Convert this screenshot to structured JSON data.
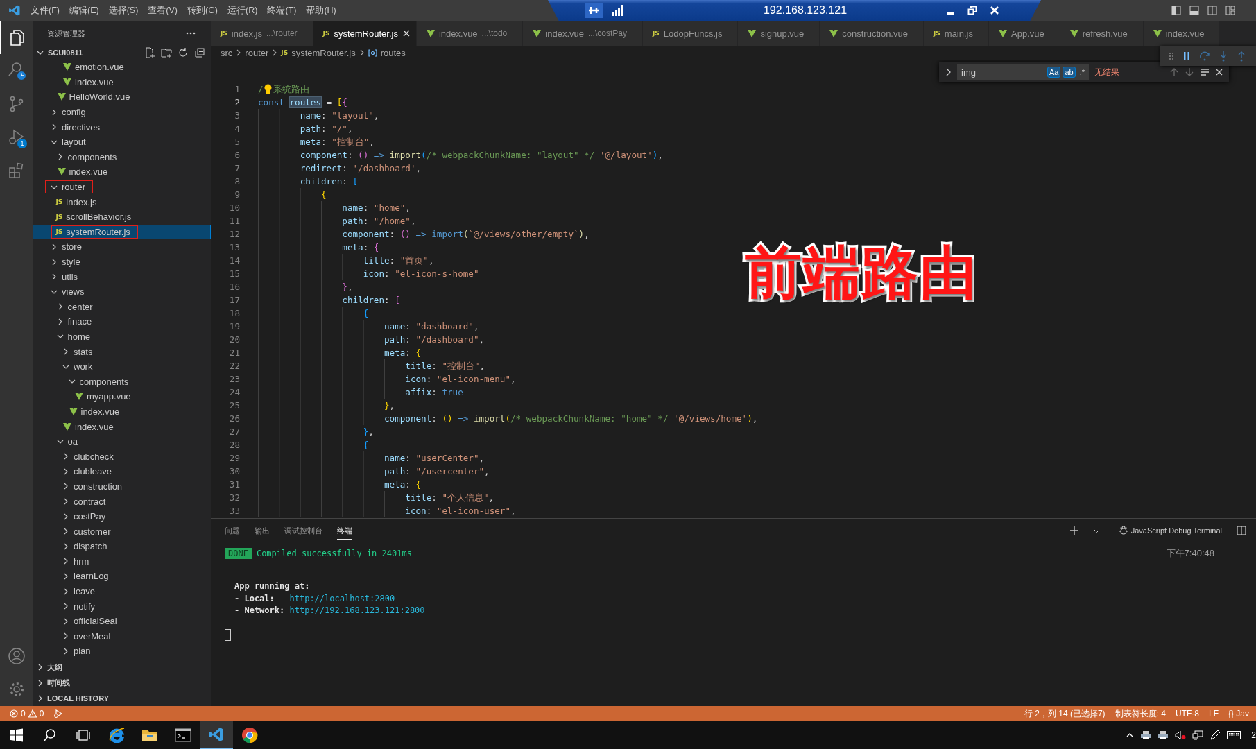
{
  "menu": [
    "文件(F)",
    "编辑(E)",
    "选择(S)",
    "查看(V)",
    "转到(G)",
    "运行(R)",
    "终端(T)",
    "帮助(H)"
  ],
  "remote_bar": {
    "title": "192.168.123.121"
  },
  "activity_bar": [
    {
      "kind": "files",
      "selected": true
    },
    {
      "kind": "search",
      "selected": false
    },
    {
      "kind": "source-control",
      "selected": false
    },
    {
      "kind": "run-debug",
      "selected": false,
      "badge": "1"
    },
    {
      "kind": "extensions",
      "selected": false
    }
  ],
  "activity_bottom": [
    {
      "kind": "account"
    },
    {
      "kind": "settings"
    }
  ],
  "sidebar": {
    "title": "资源管理器",
    "root": {
      "label": "SCUI0811",
      "expanded": true
    },
    "tree": [
      {
        "children": [
          {
            "children": [
              {
                "name": "emotion.vue",
                "kind": "vue",
                "selected": false,
                "marked": false
              },
              {
                "name": "index.vue",
                "kind": "vue",
                "selected": false,
                "marked": false
              }
            ]
          },
          {
            "name": "HelloWorld.vue",
            "kind": "vue",
            "selected": false,
            "marked": false
          }
        ]
      },
      {
        "name": "config",
        "kind": "folder",
        "expanded": false,
        "selected": false,
        "marked": false
      },
      {
        "name": "directives",
        "kind": "folder",
        "expanded": false,
        "selected": false,
        "marked": false
      },
      {
        "name": "layout",
        "kind": "folder",
        "expanded": true,
        "selected": false,
        "marked": false,
        "children": [
          {
            "name": "components",
            "kind": "folder",
            "expanded": false,
            "selected": false,
            "marked": false
          },
          {
            "name": "index.vue",
            "kind": "vue",
            "selected": false,
            "marked": false
          }
        ]
      },
      {
        "name": "router",
        "kind": "folder",
        "expanded": true,
        "selected": false,
        "marked": true,
        "children": [
          {
            "name": "index.js",
            "kind": "js",
            "badge": "JS",
            "selected": false,
            "marked": false
          },
          {
            "name": "scrollBehavior.js",
            "kind": "js",
            "badge": "JS",
            "selected": false,
            "marked": false
          },
          {
            "name": "systemRouter.js",
            "kind": "js",
            "badge": "JS",
            "selected": true,
            "marked": true
          }
        ]
      },
      {
        "name": "store",
        "kind": "folder",
        "expanded": false,
        "selected": false,
        "marked": false
      },
      {
        "name": "style",
        "kind": "folder",
        "expanded": false,
        "selected": false,
        "marked": false
      },
      {
        "name": "utils",
        "kind": "folder",
        "expanded": false,
        "selected": false,
        "marked": false
      },
      {
        "name": "views",
        "kind": "folder",
        "expanded": true,
        "selected": false,
        "marked": false,
        "children": [
          {
            "name": "center",
            "kind": "folder",
            "expanded": false,
            "selected": false,
            "marked": false
          },
          {
            "name": "finace",
            "kind": "folder",
            "expanded": false,
            "selected": false,
            "marked": false
          },
          {
            "name": "home",
            "kind": "folder",
            "expanded": true,
            "selected": false,
            "marked": false,
            "children": [
              {
                "name": "stats",
                "kind": "folder",
                "expanded": false,
                "selected": false,
                "marked": false
              },
              {
                "name": "work",
                "kind": "folder",
                "expanded": true,
                "selected": false,
                "marked": false,
                "children": [
                  {
                    "name": "components",
                    "kind": "folder",
                    "expanded": true,
                    "selected": false,
                    "marked": false,
                    "children": [
                      {
                        "name": "myapp.vue",
                        "kind": "vue",
                        "selected": false,
                        "marked": false
                      }
                    ]
                  },
                  {
                    "name": "index.vue",
                    "kind": "vue",
                    "selected": false,
                    "marked": false
                  }
                ]
              },
              {
                "name": "index.vue",
                "kind": "vue",
                "selected": false,
                "marked": false
              }
            ]
          },
          {
            "name": "oa",
            "kind": "folder",
            "expanded": true,
            "selected": false,
            "marked": false,
            "children": [
              {
                "name": "clubcheck",
                "kind": "folder",
                "expanded": false,
                "selected": false,
                "marked": false
              },
              {
                "name": "clubleave",
                "kind": "folder",
                "expanded": false,
                "selected": false,
                "marked": false
              },
              {
                "name": "construction",
                "kind": "folder",
                "expanded": false,
                "selected": false,
                "marked": false
              },
              {
                "name": "contract",
                "kind": "folder",
                "expanded": false,
                "selected": false,
                "marked": false
              },
              {
                "name": "costPay",
                "kind": "folder",
                "expanded": false,
                "selected": false,
                "marked": false
              },
              {
                "name": "customer",
                "kind": "folder",
                "expanded": false,
                "selected": false,
                "marked": false
              },
              {
                "name": "dispatch",
                "kind": "folder",
                "expanded": false,
                "selected": false,
                "marked": false
              },
              {
                "name": "hrm",
                "kind": "folder",
                "expanded": false,
                "selected": false,
                "marked": false
              },
              {
                "name": "learnLog",
                "kind": "folder",
                "expanded": false,
                "selected": false,
                "marked": false
              },
              {
                "name": "leave",
                "kind": "folder",
                "expanded": false,
                "selected": false,
                "marked": false
              },
              {
                "name": "notify",
                "kind": "folder",
                "expanded": false,
                "selected": false,
                "marked": false
              },
              {
                "name": "officialSeal",
                "kind": "folder",
                "expanded": false,
                "selected": false,
                "marked": false
              },
              {
                "name": "overMeal",
                "kind": "folder",
                "expanded": false,
                "selected": false,
                "marked": false
              },
              {
                "name": "plan",
                "kind": "folder",
                "expanded": false,
                "selected": false,
                "marked": false
              }
            ]
          }
        ]
      }
    ],
    "sections": [
      {
        "label": "大纲",
        "expanded": false
      },
      {
        "label": "时间线",
        "expanded": false
      },
      {
        "label": "LOCAL HISTORY",
        "expanded": false
      }
    ]
  },
  "tabs": [
    {
      "label": "index.js",
      "description": "...\\router",
      "kind": "js",
      "badge": "JS",
      "selected": false
    },
    {
      "label": "systemRouter.js",
      "kind": "js",
      "badge": "JS",
      "selected": true
    },
    {
      "label": "index.vue",
      "description": "...\\todo",
      "kind": "vue",
      "selected": false
    },
    {
      "label": "index.vue",
      "description": "...\\costPay",
      "kind": "vue",
      "selected": false
    },
    {
      "label": "LodopFuncs.js",
      "kind": "js",
      "badge": "JS",
      "selected": false
    },
    {
      "label": "signup.vue",
      "kind": "vue",
      "selected": false
    },
    {
      "label": "construction.vue",
      "kind": "vue",
      "selected": false
    },
    {
      "label": "main.js",
      "kind": "js",
      "badge": "JS",
      "selected": false
    },
    {
      "label": "App.vue",
      "kind": "vue",
      "selected": false
    },
    {
      "label": "refresh.vue",
      "kind": "vue",
      "selected": false
    },
    {
      "label": "index.vue",
      "kind": "vue",
      "selected": false
    }
  ],
  "breadcrumb": [
    {
      "text": "src",
      "kind": "folder"
    },
    {
      "text": "router",
      "kind": "folder"
    },
    {
      "text": "systemRouter.js",
      "kind": "js",
      "badge": "JS"
    },
    {
      "text": "routes",
      "kind": "symbol"
    }
  ],
  "find_widget": {
    "query": "img",
    "options": [
      {
        "label": "Aa",
        "on": true
      },
      {
        "label": "ab",
        "on": true
      },
      {
        "label": ".*",
        "on": false
      }
    ],
    "result": "无结果"
  },
  "code": [
    {
      "n": "1",
      "active": false,
      "t": [
        {
          "kind": "comment",
          "text": "/"
        },
        {
          "kind": "bulb"
        },
        {
          "kind": "comment",
          "text": "系统路由"
        }
      ]
    },
    {
      "n": "2",
      "active": true,
      "t": [
        {
          "kind": "kw",
          "text": "const "
        },
        {
          "kind": "sel",
          "text": "routes"
        },
        {
          "kind": "punc",
          "text": " = "
        },
        {
          "kind": "bracket1",
          "text": "["
        },
        {
          "kind": "bracket2",
          "text": "{"
        }
      ]
    },
    {
      "n": "3",
      "active": false,
      "t": [
        {
          "kind": "prop",
          "text": "        name"
        },
        {
          "kind": "punc",
          "text": ": "
        },
        {
          "kind": "str",
          "text": "\"layout\""
        },
        {
          "kind": "punc",
          "text": ","
        }
      ]
    },
    {
      "n": "4",
      "active": false,
      "t": [
        {
          "kind": "prop",
          "text": "        path"
        },
        {
          "kind": "punc",
          "text": ": "
        },
        {
          "kind": "str",
          "text": "\"/\""
        },
        {
          "kind": "punc",
          "text": ","
        }
      ]
    },
    {
      "n": "5",
      "active": false,
      "t": [
        {
          "kind": "prop",
          "text": "        meta"
        },
        {
          "kind": "punc",
          "text": ": "
        },
        {
          "kind": "str",
          "text": "\"控制台\""
        },
        {
          "kind": "punc",
          "text": ","
        }
      ]
    },
    {
      "n": "6",
      "active": false,
      "t": [
        {
          "kind": "prop",
          "text": "        component"
        },
        {
          "kind": "punc",
          "text": ": "
        },
        {
          "kind": "bracket2",
          "text": "()"
        },
        {
          "kind": "kw",
          "text": " => "
        },
        {
          "kind": "fn",
          "text": "import"
        },
        {
          "kind": "bracket3",
          "text": "("
        },
        {
          "kind": "comment",
          "text": "/* webpackChunkName: \"layout\" */ "
        },
        {
          "kind": "str",
          "text": "'@/layout'"
        },
        {
          "kind": "bracket3",
          "text": ")"
        },
        {
          "kind": "punc",
          "text": ","
        }
      ]
    },
    {
      "n": "7",
      "active": false,
      "t": [
        {
          "kind": "prop",
          "text": "        redirect"
        },
        {
          "kind": "punc",
          "text": ": "
        },
        {
          "kind": "str",
          "text": "'/dashboard'"
        },
        {
          "kind": "punc",
          "text": ","
        }
      ]
    },
    {
      "n": "8",
      "active": false,
      "t": [
        {
          "kind": "prop",
          "text": "        children"
        },
        {
          "kind": "punc",
          "text": ": "
        },
        {
          "kind": "bracket3",
          "text": "["
        }
      ]
    },
    {
      "n": "9",
      "active": false,
      "t": [
        {
          "kind": "bracket1",
          "text": "            {"
        }
      ]
    },
    {
      "n": "10",
      "active": false,
      "t": [
        {
          "kind": "prop",
          "text": "                name"
        },
        {
          "kind": "punc",
          "text": ": "
        },
        {
          "kind": "str",
          "text": "\"home\""
        },
        {
          "kind": "punc",
          "text": ","
        }
      ]
    },
    {
      "n": "11",
      "active": false,
      "t": [
        {
          "kind": "prop",
          "text": "                path"
        },
        {
          "kind": "punc",
          "text": ": "
        },
        {
          "kind": "str",
          "text": "\"/home\""
        },
        {
          "kind": "punc",
          "text": ","
        }
      ]
    },
    {
      "n": "12",
      "active": false,
      "t": [
        {
          "kind": "prop",
          "text": "                component"
        },
        {
          "kind": "punc",
          "text": ": "
        },
        {
          "kind": "bracket2",
          "text": "()"
        },
        {
          "kind": "kw",
          "text": " => import"
        },
        {
          "kind": "fn",
          "text": "("
        },
        {
          "kind": "str",
          "text": "`@/views/other/empty`"
        },
        {
          "kind": "fn",
          "text": ")"
        },
        {
          "kind": "punc",
          "text": ","
        }
      ]
    },
    {
      "n": "13",
      "active": false,
      "t": [
        {
          "kind": "prop",
          "text": "                meta"
        },
        {
          "kind": "punc",
          "text": ": "
        },
        {
          "kind": "bracket2",
          "text": "{"
        }
      ]
    },
    {
      "n": "14",
      "active": false,
      "t": [
        {
          "kind": "prop",
          "text": "                    title"
        },
        {
          "kind": "punc",
          "text": ": "
        },
        {
          "kind": "str",
          "text": "\"首页\""
        },
        {
          "kind": "punc",
          "text": ","
        }
      ]
    },
    {
      "n": "15",
      "active": false,
      "t": [
        {
          "kind": "prop",
          "text": "                    icon"
        },
        {
          "kind": "punc",
          "text": ": "
        },
        {
          "kind": "str",
          "text": "\"el-icon-s-home\""
        }
      ]
    },
    {
      "n": "16",
      "active": false,
      "t": [
        {
          "kind": "bracket2",
          "text": "                }"
        },
        {
          "kind": "punc",
          "text": ","
        }
      ]
    },
    {
      "n": "17",
      "active": false,
      "t": [
        {
          "kind": "prop",
          "text": "                children"
        },
        {
          "kind": "punc",
          "text": ": "
        },
        {
          "kind": "bracket2",
          "text": "["
        }
      ]
    },
    {
      "n": "18",
      "active": false,
      "t": [
        {
          "kind": "bracket3",
          "text": "                    {"
        }
      ]
    },
    {
      "n": "19",
      "active": false,
      "t": [
        {
          "kind": "prop",
          "text": "                        name"
        },
        {
          "kind": "punc",
          "text": ": "
        },
        {
          "kind": "str",
          "text": "\"dashboard\""
        },
        {
          "kind": "punc",
          "text": ","
        }
      ]
    },
    {
      "n": "20",
      "active": false,
      "t": [
        {
          "kind": "prop",
          "text": "                        path"
        },
        {
          "kind": "punc",
          "text": ": "
        },
        {
          "kind": "str",
          "text": "\"/dashboard\""
        },
        {
          "kind": "punc",
          "text": ","
        }
      ]
    },
    {
      "n": "21",
      "active": false,
      "t": [
        {
          "kind": "prop",
          "text": "                        meta"
        },
        {
          "kind": "punc",
          "text": ": "
        },
        {
          "kind": "bracket1",
          "text": "{"
        }
      ]
    },
    {
      "n": "22",
      "active": false,
      "t": [
        {
          "kind": "prop",
          "text": "                            title"
        },
        {
          "kind": "punc",
          "text": ": "
        },
        {
          "kind": "str",
          "text": "\"控制台\""
        },
        {
          "kind": "punc",
          "text": ","
        }
      ]
    },
    {
      "n": "23",
      "active": false,
      "t": [
        {
          "kind": "prop",
          "text": "                            icon"
        },
        {
          "kind": "punc",
          "text": ": "
        },
        {
          "kind": "str",
          "text": "\"el-icon-menu\""
        },
        {
          "kind": "punc",
          "text": ","
        }
      ]
    },
    {
      "n": "24",
      "active": false,
      "t": [
        {
          "kind": "prop",
          "text": "                            affix"
        },
        {
          "kind": "punc",
          "text": ": "
        },
        {
          "kind": "kw",
          "text": "true"
        }
      ]
    },
    {
      "n": "25",
      "active": false,
      "t": [
        {
          "kind": "bracket1",
          "text": "                        }"
        },
        {
          "kind": "punc",
          "text": ","
        }
      ]
    },
    {
      "n": "26",
      "active": false,
      "t": [
        {
          "kind": "prop",
          "text": "                        component"
        },
        {
          "kind": "punc",
          "text": ": "
        },
        {
          "kind": "bracket1",
          "text": "()"
        },
        {
          "kind": "kw",
          "text": " => "
        },
        {
          "kind": "fn",
          "text": "import"
        },
        {
          "kind": "bracket1",
          "text": "("
        },
        {
          "kind": "comment",
          "text": "/* webpackChunkName: \"home\" */ "
        },
        {
          "kind": "str",
          "text": "'@/views/home'"
        },
        {
          "kind": "bracket1",
          "text": ")"
        },
        {
          "kind": "punc",
          "text": ","
        }
      ]
    },
    {
      "n": "27",
      "active": false,
      "t": [
        {
          "kind": "bracket3",
          "text": "                    }"
        },
        {
          "kind": "punc",
          "text": ","
        }
      ]
    },
    {
      "n": "28",
      "active": false,
      "t": [
        {
          "kind": "bracket3",
          "text": "                    {"
        }
      ]
    },
    {
      "n": "29",
      "active": false,
      "t": [
        {
          "kind": "prop",
          "text": "                        name"
        },
        {
          "kind": "punc",
          "text": ": "
        },
        {
          "kind": "str",
          "text": "\"userCenter\""
        },
        {
          "kind": "punc",
          "text": ","
        }
      ]
    },
    {
      "n": "30",
      "active": false,
      "t": [
        {
          "kind": "prop",
          "text": "                        path"
        },
        {
          "kind": "punc",
          "text": ": "
        },
        {
          "kind": "str",
          "text": "\"/usercenter\""
        },
        {
          "kind": "punc",
          "text": ","
        }
      ]
    },
    {
      "n": "31",
      "active": false,
      "t": [
        {
          "kind": "prop",
          "text": "                        meta"
        },
        {
          "kind": "punc",
          "text": ": "
        },
        {
          "kind": "bracket1",
          "text": "{"
        }
      ]
    },
    {
      "n": "32",
      "active": false,
      "t": [
        {
          "kind": "prop",
          "text": "                            title"
        },
        {
          "kind": "punc",
          "text": ": "
        },
        {
          "kind": "str",
          "text": "\"个人信息\""
        },
        {
          "kind": "punc",
          "text": ","
        }
      ]
    },
    {
      "n": "33",
      "active": false,
      "t": [
        {
          "kind": "prop",
          "text": "                            icon"
        },
        {
          "kind": "punc",
          "text": ": "
        },
        {
          "kind": "str",
          "text": "\"el-icon-user\""
        },
        {
          "kind": "punc",
          "text": ","
        }
      ]
    }
  ],
  "caption": "前端路由",
  "panel": {
    "tabs": [
      {
        "label": "问题",
        "selected": false
      },
      {
        "label": "输出",
        "selected": false
      },
      {
        "label": "调试控制台",
        "selected": false
      },
      {
        "label": "终端",
        "selected": true
      }
    ],
    "profile": "JavaScript Debug Terminal",
    "terminal": {
      "badge": "DONE",
      "message": "Compiled successfully in 2401ms",
      "time": "下午7:40:48",
      "heading": "App running at:",
      "links": [
        {
          "label": "- Local:   ",
          "url": "http://localhost:2800"
        },
        {
          "label": "- Network: ",
          "url": "http://192.168.123.121:2800"
        }
      ]
    }
  },
  "status_bar": {
    "errors": "0",
    "warnings": "0",
    "right": [
      "行 2，列 14 (已选择7)",
      "制表符长度: 4",
      "UTF-8",
      "LF",
      "{} Jav"
    ]
  },
  "taskbar": {
    "apps": [
      {
        "kind": "start",
        "selected": false
      },
      {
        "kind": "search",
        "selected": false
      },
      {
        "kind": "task-view",
        "selected": false
      },
      {
        "kind": "browser-e",
        "selected": false
      },
      {
        "kind": "explorer",
        "selected": false
      },
      {
        "kind": "terminal",
        "selected": false
      },
      {
        "kind": "vscode",
        "selected": true
      },
      {
        "kind": "chrome",
        "selected": false
      }
    ],
    "tray": [
      {
        "kind": "chevron"
      },
      {
        "kind": "printer"
      },
      {
        "kind": "printer"
      },
      {
        "kind": "volume-muted"
      },
      {
        "kind": "network"
      },
      {
        "kind": "pen"
      },
      {
        "kind": "keyboard"
      }
    ],
    "clock": "2"
  }
}
